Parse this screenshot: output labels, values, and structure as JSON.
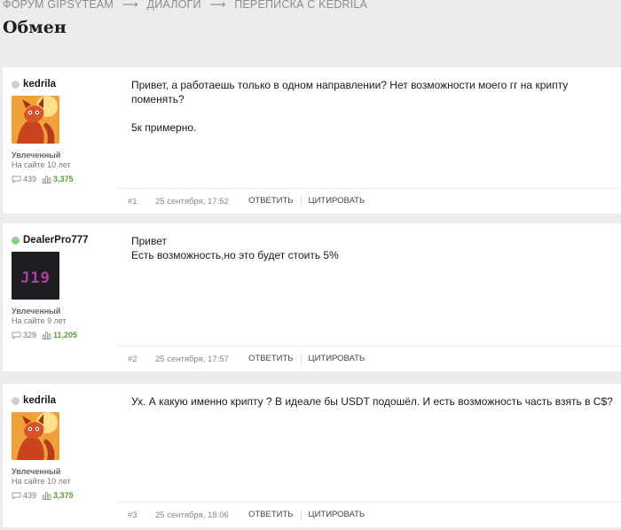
{
  "breadcrumb": {
    "items": [
      "Форум GIPSYTEAM",
      "Диалоги",
      "Переписка с kedrila"
    ],
    "separator": "⟶"
  },
  "page_title": "Обмен",
  "actions": {
    "reply": "Ответить",
    "quote": "Цитировать"
  },
  "posts": [
    {
      "username": "kedrila",
      "online": false,
      "avatar": "fox-avatar",
      "role": "Увлеченный",
      "since": "На сайте 10 лет",
      "messages": "439",
      "likes": "3,375",
      "lines": [
        "Привет, а работаешь только в одном направлении? Нет возможности моего гг на крипту поменять?",
        "5к примерно."
      ],
      "number": "#1",
      "date": "25 сентября, 17:52"
    },
    {
      "username": "DealerPro777",
      "online": true,
      "avatar": "j19-avatar",
      "avatar_text": "J19",
      "role": "Увлеченный",
      "since": "На сайте 9 лет",
      "messages": "329",
      "likes": "11,205",
      "lines": [
        "Привет",
        "Есть возможность,но это будет стоить 5%"
      ],
      "number": "#2",
      "date": "25 сентября, 17:57"
    },
    {
      "username": "kedrila",
      "online": false,
      "avatar": "fox-avatar",
      "role": "Увлеченный",
      "since": "На сайте 10 лет",
      "messages": "439",
      "likes": "3,375",
      "lines": [
        "Ух. А какую именно крипту ? В идеале бы USDT подошёл. И есть возможность часть взять в C$?"
      ],
      "number": "#3",
      "date": "25 сентября, 18:06"
    }
  ],
  "colors": {
    "online": "#8ed08a",
    "offline": "#cfcfcf",
    "likes": "#5a9a3a"
  }
}
